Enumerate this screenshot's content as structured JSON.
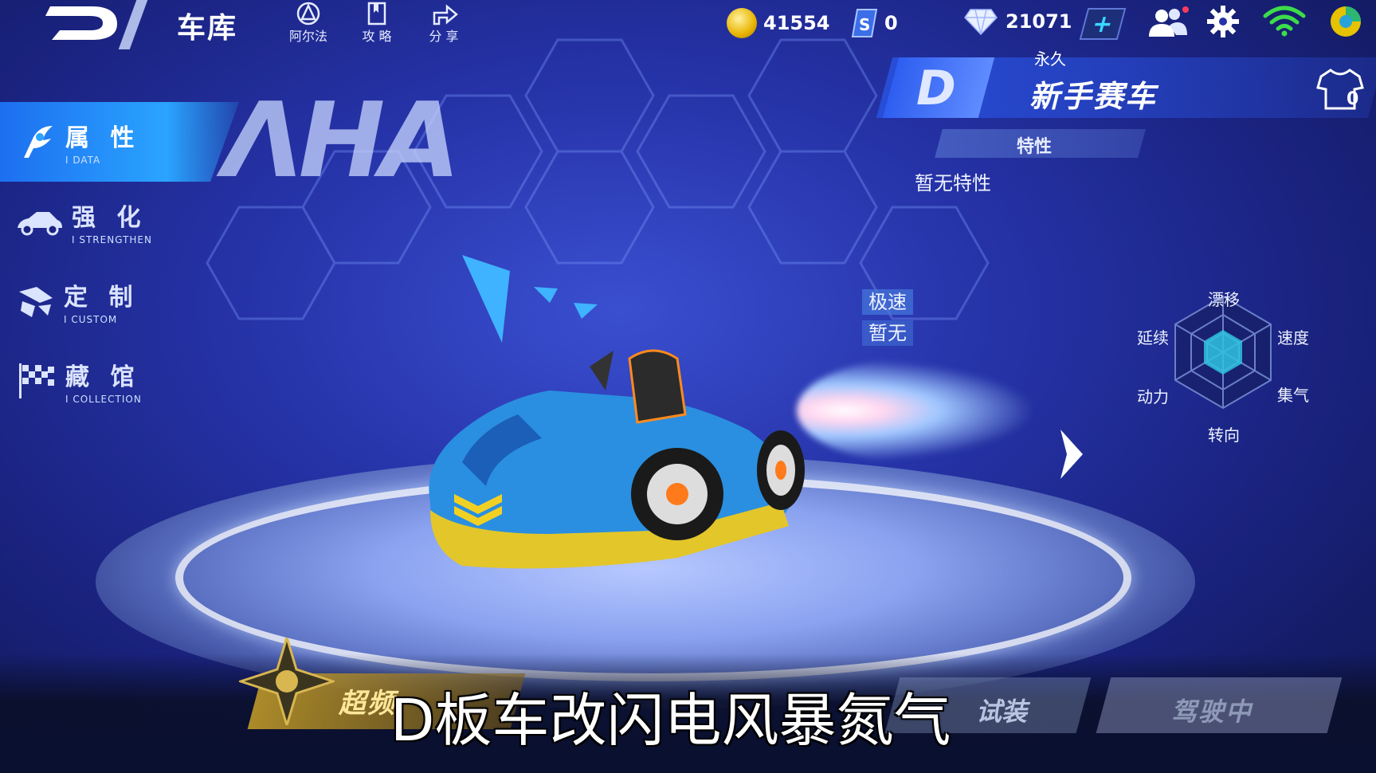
{
  "topbar": {
    "title": "车库",
    "icons": [
      {
        "name": "alpha-icon",
        "label": "阿尔法"
      },
      {
        "name": "guide-icon",
        "label": "攻 略"
      },
      {
        "name": "share-icon",
        "label": "分 享"
      }
    ],
    "coins": "41554",
    "tickets": "0",
    "diamonds": "21071"
  },
  "menu": [
    {
      "title": "属 性",
      "sub": "I DATA",
      "active": true
    },
    {
      "title": "强 化",
      "sub": "I STRENGTHEN",
      "active": false
    },
    {
      "title": "定 制",
      "sub": "I CUSTOM",
      "active": false
    },
    {
      "title": "藏 馆",
      "sub": "I COLLECTION",
      "active": false
    }
  ],
  "watermark": "ΛHA",
  "car": {
    "grade": "D",
    "duration": "永久",
    "name": "新手赛车",
    "outfit_count": "0",
    "trait_header": "特性",
    "trait_value": "暂无特性",
    "tags": [
      "极速",
      "暂无"
    ]
  },
  "radar": {
    "labels": {
      "top": "漂移",
      "top_right": "速度",
      "bottom_right": "集气",
      "bottom": "转向",
      "bottom_left": "动力",
      "top_left": "延续"
    }
  },
  "bottom": {
    "overclock_label": "超频",
    "try_label": "试装",
    "driving_label": "驾驶中"
  },
  "subtitle": "D板车改闪电风暴氮气",
  "colors": {
    "accent": "#2aa4ff",
    "background": "#2633a8",
    "gold": "#e8b400"
  }
}
